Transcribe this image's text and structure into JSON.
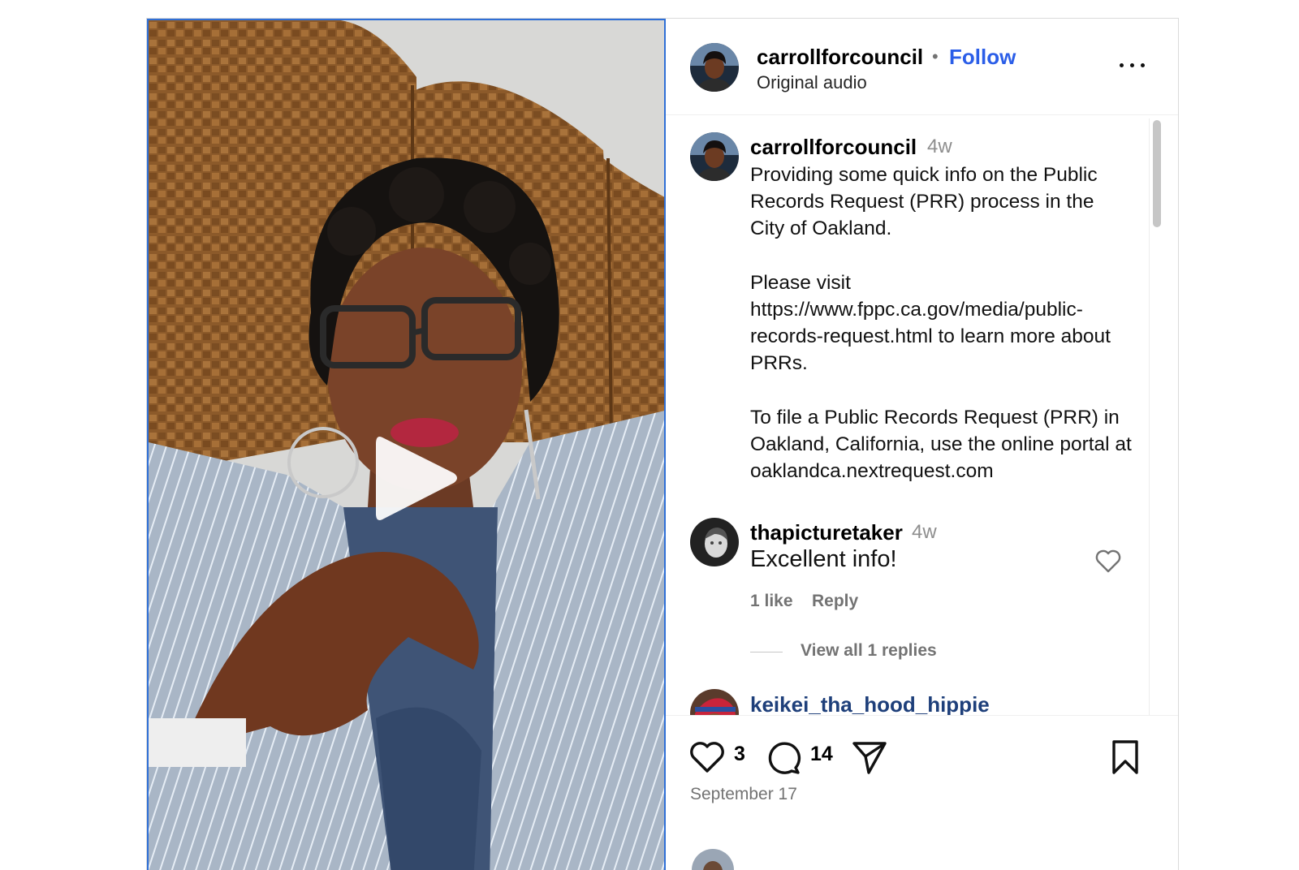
{
  "header": {
    "username": "carrollforcouncil",
    "separator": "•",
    "follow_label": "Follow",
    "audio_label": "Original audio"
  },
  "caption": {
    "username": "carrollforcouncil",
    "time": "4w",
    "text": "Providing some quick info on the Public Records Request (PRR) process in the City of Oakland.\n\nPlease visit https://www.fppc.ca.gov/media/public-records-request.html to learn more about PRRs.\n\nTo file a Public Records Request (PRR) in Oakland, California, use the online portal at oaklandca.nextrequest.com"
  },
  "comments": [
    {
      "username": "thapicturetaker",
      "time": "4w",
      "text": "Excellent info!",
      "likes": "1 like",
      "reply_label": "Reply",
      "view_replies": "View all 1 replies"
    },
    {
      "username": "keikei_tha_hood_hippie"
    }
  ],
  "actions": {
    "like_count": "3",
    "comment_count": "14",
    "date": "September 17"
  },
  "icons": {
    "more": "more-horizontal-icon",
    "play": "play-icon",
    "like": "heart-icon",
    "comment": "comment-bubble-icon",
    "share": "paper-plane-icon",
    "save": "bookmark-icon"
  },
  "colors": {
    "follow": "#2b5ee8",
    "media_border": "#2f6fd6",
    "secondary_text": "#737373"
  }
}
